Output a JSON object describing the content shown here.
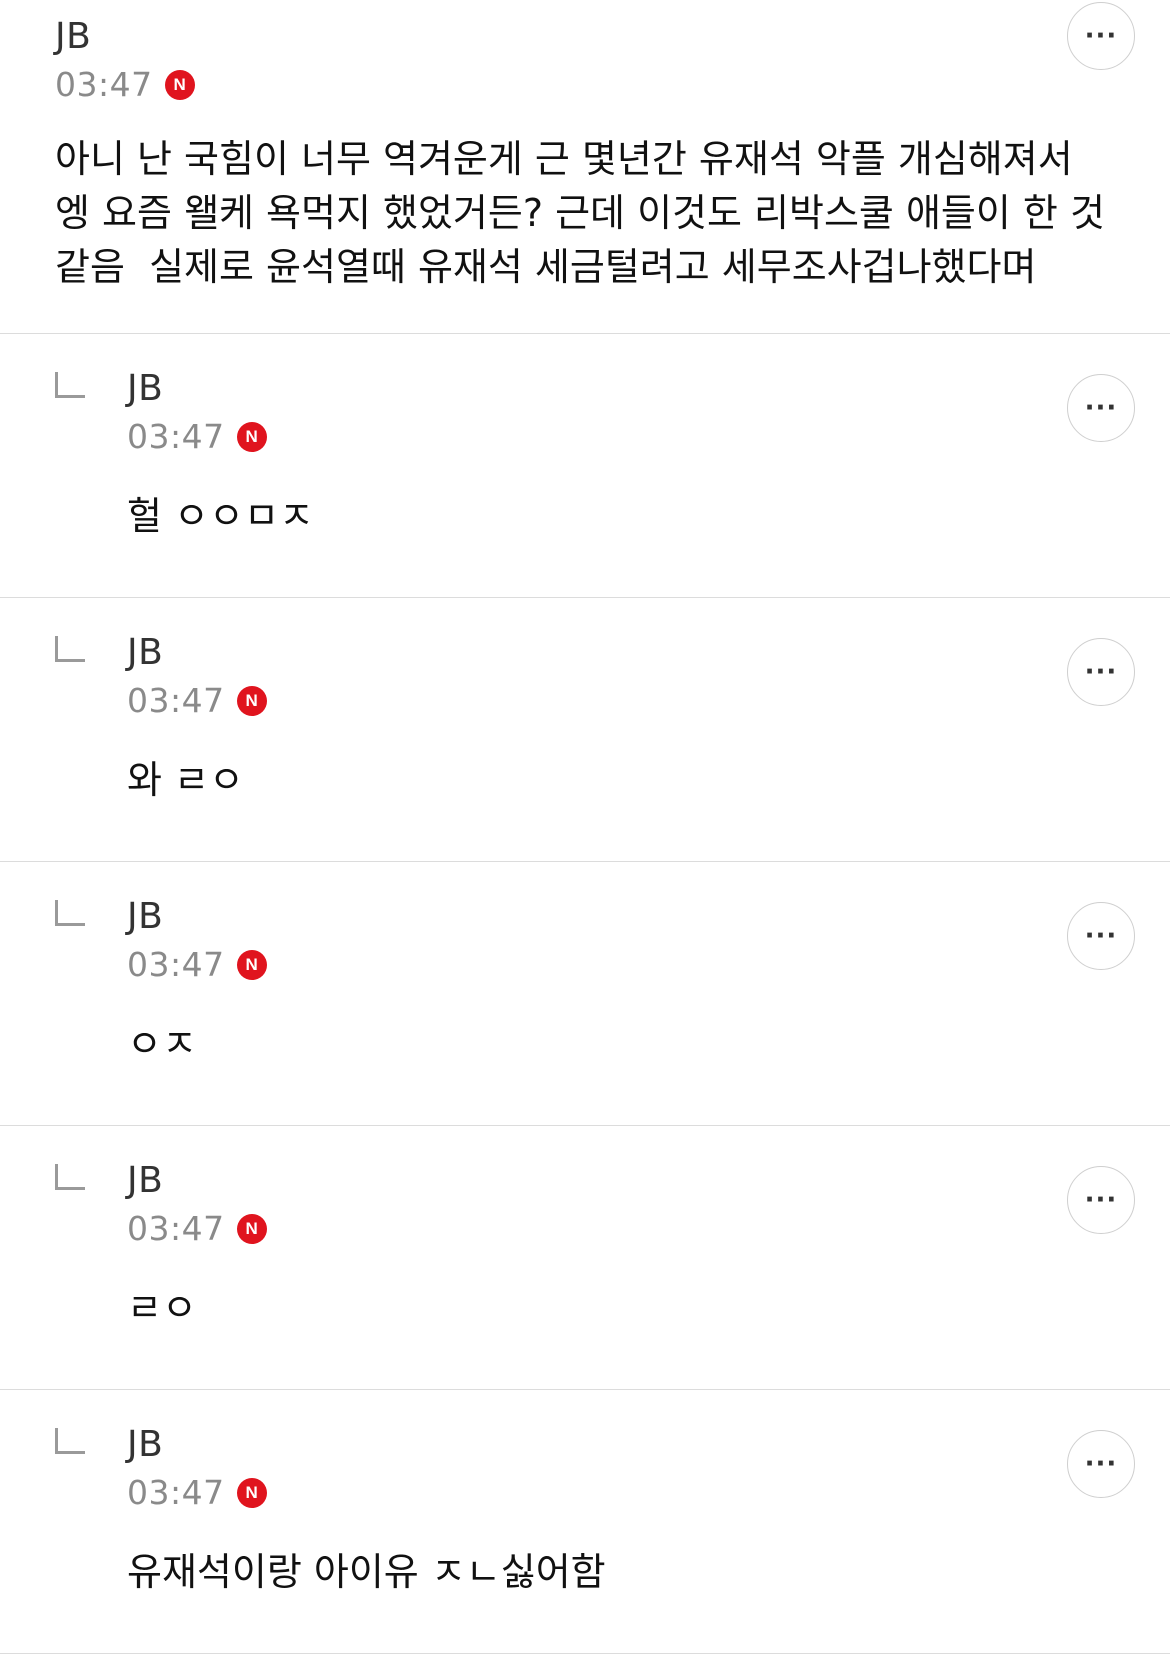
{
  "comments": [
    {
      "author": "JB",
      "time": "03:47",
      "badge": "N",
      "text": "아니 난 국힘이 너무 역겨운게 근 몇년간 유재석 악플 개심해져서 엥 요즘 왤케 욕먹지 했었거든? 근데 이것도 리박스쿨 애들이 한 것 같음  실제로 윤석열때 유재석 세금털려고 세무조사겁나했다며",
      "more_icon": "ellipsis-icon",
      "more_label": "···"
    },
    {
      "author": "JB",
      "time": "03:47",
      "badge": "N",
      "text": "헐 ㅇㅇㅁㅈ",
      "more_icon": "ellipsis-icon",
      "more_label": "···"
    },
    {
      "author": "JB",
      "time": "03:47",
      "badge": "N",
      "text": "와 ㄹㅇ",
      "more_icon": "ellipsis-icon",
      "more_label": "···"
    },
    {
      "author": "JB",
      "time": "03:47",
      "badge": "N",
      "text": "ㅇㅈ",
      "more_icon": "ellipsis-icon",
      "more_label": "···"
    },
    {
      "author": "JB",
      "time": "03:47",
      "badge": "N",
      "text": "ㄹㅇ",
      "more_icon": "ellipsis-icon",
      "more_label": "···"
    },
    {
      "author": "JB",
      "time": "03:47",
      "badge": "N",
      "text": "유재석이랑 아이유 ㅈㄴ싫어함",
      "more_icon": "ellipsis-icon",
      "more_label": "···"
    }
  ],
  "colors": {
    "badge": "#e0141e",
    "divider": "#dcdcdc",
    "meta_text": "#8a8a8a"
  }
}
